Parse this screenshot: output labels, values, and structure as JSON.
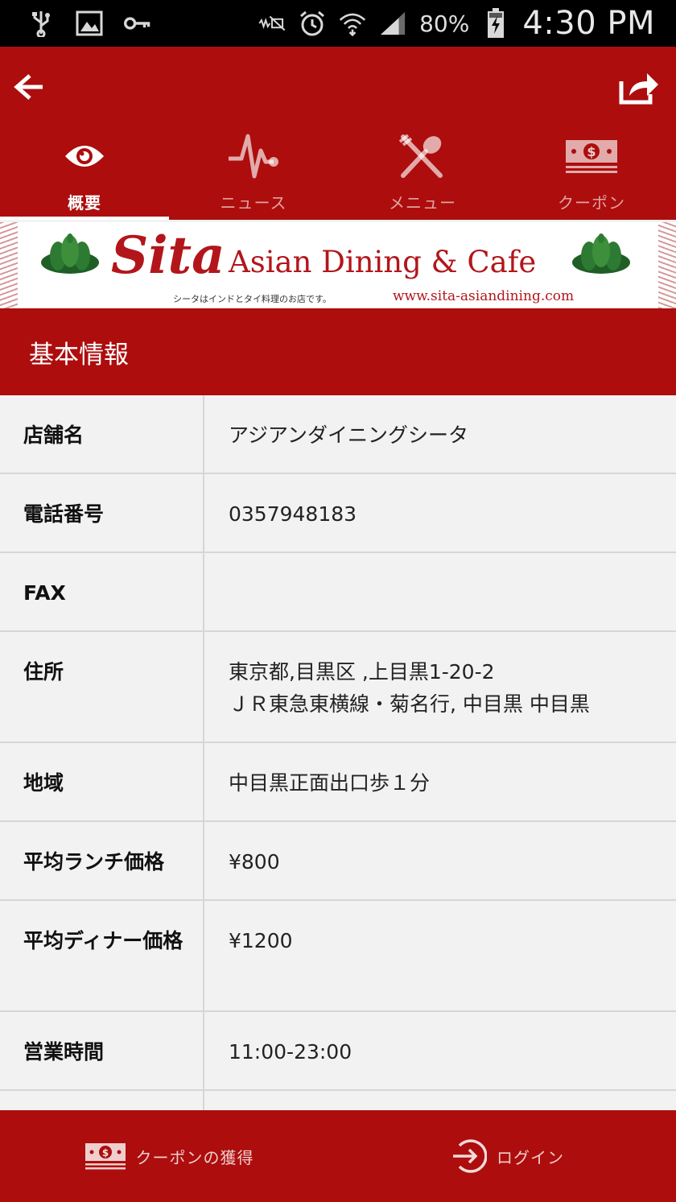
{
  "status_bar": {
    "icons": [
      "usb-icon",
      "image-icon",
      "key-icon",
      "mute-icon",
      "alarm-icon",
      "wifi-icon",
      "signal-icon",
      "battery-icon"
    ],
    "battery": "80%",
    "time": "4:30 PM"
  },
  "header": {
    "tabs": [
      {
        "label": "概要",
        "icon": "eye-icon",
        "active": true
      },
      {
        "label": "ニュース",
        "icon": "pulse-icon",
        "active": false
      },
      {
        "label": "メニュー",
        "icon": "utensils-icon",
        "active": false
      },
      {
        "label": "クーポン",
        "icon": "money-icon",
        "active": false
      }
    ]
  },
  "banner": {
    "logo": "Sita",
    "title": "Asian Dining & Cafe",
    "subtitle": "シータはインドとタイ料理のお店です。",
    "url": "www.sita-asiandining.com"
  },
  "section": {
    "title": "基本情報"
  },
  "info": {
    "rows": [
      {
        "label": "店舗名",
        "value": "アジアンダイニングシータ",
        "value2": ""
      },
      {
        "label": "電話番号",
        "value": "0357948183",
        "value2": ""
      },
      {
        "label": "FAX",
        "value": "",
        "value2": ""
      },
      {
        "label": "住所",
        "value": "東京都,目黒区 ,上目黒1-20-2",
        "value2": "ＪＲ東急東横線・菊名行, 中目黒 中目黒"
      },
      {
        "label": "地域",
        "value": "中目黒正面出口歩１分",
        "value2": ""
      },
      {
        "label": "平均ランチ価格",
        "value": "¥800",
        "value2": ""
      },
      {
        "label": "平均ディナー価格",
        "value": "¥1200",
        "value2": ""
      },
      {
        "label": "営業時間",
        "value": "11:00-23:00",
        "value2": ""
      }
    ]
  },
  "bottom_bar": {
    "coupon_label": "クーポンの獲得",
    "login_label": "ログイン"
  },
  "colors": {
    "brand_red": "#ad0d0d",
    "background": "#f2f2f2"
  }
}
